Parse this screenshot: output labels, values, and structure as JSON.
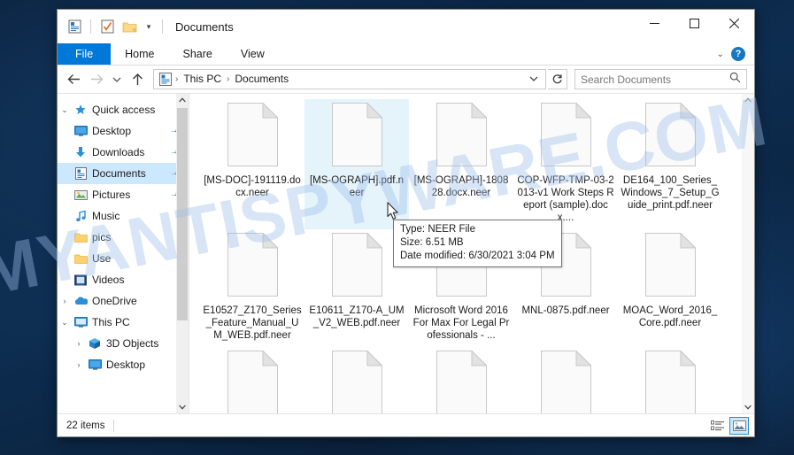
{
  "window": {
    "title": "Documents",
    "quick_access_icons": [
      "document-icon",
      "properties-icon",
      "new-folder-icon"
    ],
    "qat_caret": "▾",
    "minimize_label": "—",
    "maximize_label": "▢",
    "close_label": "✕"
  },
  "ribbon": {
    "tabs": [
      {
        "label": "File",
        "active": true
      },
      {
        "label": "Home",
        "active": false
      },
      {
        "label": "Share",
        "active": false
      },
      {
        "label": "View",
        "active": false
      }
    ],
    "collapse_caret": "⌄",
    "help_label": "?"
  },
  "address_bar": {
    "back_icon": "←",
    "forward_icon": "→",
    "history_caret": "⌄",
    "up_icon": "↑",
    "breadcrumbs": [
      "This PC",
      "Documents"
    ],
    "separator": "›",
    "dropdown_caret": "⌄",
    "refresh_icon": "↻"
  },
  "search": {
    "placeholder": "Search Documents",
    "value": "",
    "icon": "search-icon"
  },
  "sidebar": {
    "items": [
      {
        "label": "Quick access",
        "icon": "star-icon",
        "expander": "⌄",
        "indent": 1,
        "pinned": false,
        "selected": false
      },
      {
        "label": "Desktop",
        "icon": "desktop-icon",
        "expander": "",
        "indent": 2,
        "pinned": true,
        "selected": false
      },
      {
        "label": "Downloads",
        "icon": "download-icon",
        "expander": "",
        "indent": 2,
        "pinned": true,
        "selected": false
      },
      {
        "label": "Documents",
        "icon": "documents-icon",
        "expander": "",
        "indent": 2,
        "pinned": true,
        "selected": true
      },
      {
        "label": "Pictures",
        "icon": "pictures-icon",
        "expander": "",
        "indent": 2,
        "pinned": true,
        "selected": false
      },
      {
        "label": "Music",
        "icon": "music-icon",
        "expander": "",
        "indent": 2,
        "pinned": false,
        "selected": false
      },
      {
        "label": "pics",
        "icon": "folder-icon",
        "expander": "",
        "indent": 2,
        "pinned": false,
        "selected": false
      },
      {
        "label": "Use",
        "icon": "folder-icon",
        "expander": "",
        "indent": 2,
        "pinned": false,
        "selected": false
      },
      {
        "label": "Videos",
        "icon": "videos-icon",
        "expander": "",
        "indent": 2,
        "pinned": false,
        "selected": false
      },
      {
        "label": "OneDrive",
        "icon": "onedrive-icon",
        "expander": "›",
        "indent": 1,
        "pinned": false,
        "selected": false
      },
      {
        "label": "This PC",
        "icon": "thispc-icon",
        "expander": "⌄",
        "indent": 1,
        "pinned": false,
        "selected": false
      },
      {
        "label": "3D Objects",
        "icon": "3dobjects-icon",
        "expander": "›",
        "indent": 2,
        "pinned": false,
        "selected": false
      },
      {
        "label": "Desktop",
        "icon": "desktop-icon",
        "expander": "›",
        "indent": 2,
        "pinned": false,
        "selected": false
      }
    ]
  },
  "files": [
    {
      "name": "[MS-DOC]-191119.docx.neer",
      "hover": false
    },
    {
      "name": "[MS-OGRAPH].pdf.neer",
      "hover": true
    },
    {
      "name": "[MS-OGRAPH]-180828.docx.neer",
      "hover": false
    },
    {
      "name": "COP-WFP-TMP-03-2013-v1 Work Steps Report (sample).docx....",
      "hover": false
    },
    {
      "name": "DE164_100_Series_Windows_7_Setup_Guide_print.pdf.neer",
      "hover": false
    },
    {
      "name": "E10527_Z170_Series_Feature_Manual_UM_WEB.pdf.neer",
      "hover": false
    },
    {
      "name": "E10611_Z170-A_UM_V2_WEB.pdf.neer",
      "hover": false
    },
    {
      "name": "Microsoft Word 2016 For Max For Legal Professionals - ...",
      "hover": false
    },
    {
      "name": "MNL-0875.pdf.neer",
      "hover": false
    },
    {
      "name": "MOAC_Word_2016_Core.pdf.neer",
      "hover": false
    }
  ],
  "tooltip": {
    "type": "Type: NEER File",
    "size": "Size: 6.51 MB",
    "modified": "Date modified: 6/30/2021 3:04 PM"
  },
  "status_bar": {
    "item_count": "22 items",
    "details_view_icon": "details-view-icon",
    "icons_view_icon": "large-icons-view-icon"
  },
  "watermark": {
    "text": "MYANTISPYWARE.COM",
    "color": "#9dc0ea"
  }
}
